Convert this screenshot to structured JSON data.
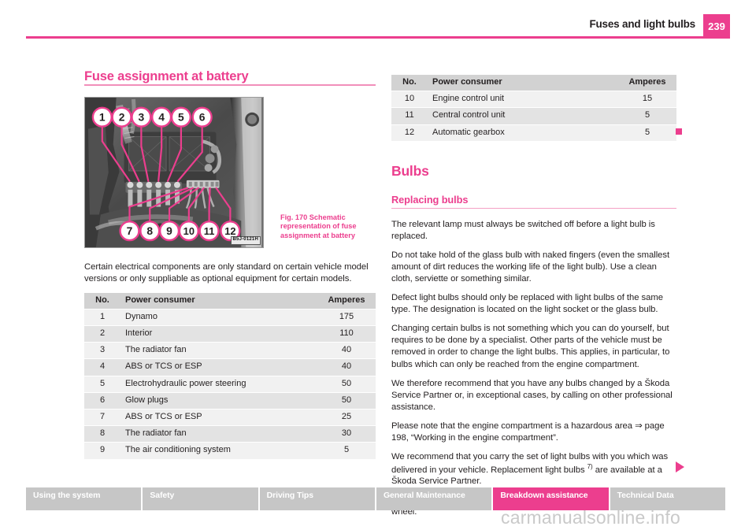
{
  "header": {
    "title": "Fuses and light bulbs",
    "page_number": "239"
  },
  "left_column": {
    "section_title": "Fuse assignment at battery",
    "figure": {
      "caption": "Fig. 170   Schematic representation of fuse assignment at battery",
      "image_code": "B5J-0121H",
      "callout_labels_top": [
        "1",
        "2",
        "3",
        "4",
        "5",
        "6"
      ],
      "callout_labels_bottom": [
        "7",
        "8",
        "9",
        "10",
        "11",
        "12"
      ]
    },
    "intro_paragraph": "Certain electrical components are only standard on certain vehicle model versions or only suppliable as optional equipment for certain models.",
    "table": {
      "columns": [
        "No.",
        "Power consumer",
        "Amperes"
      ],
      "rows": [
        {
          "no": "1",
          "consumer": "Dynamo",
          "amperes": "175"
        },
        {
          "no": "2",
          "consumer": "Interior",
          "amperes": "110"
        },
        {
          "no": "3",
          "consumer": "The radiator fan",
          "amperes": "40"
        },
        {
          "no": "4",
          "consumer": "ABS or TCS or ESP",
          "amperes": "40"
        },
        {
          "no": "5",
          "consumer": "Electrohydraulic power steering",
          "amperes": "50"
        },
        {
          "no": "6",
          "consumer": "Glow plugs",
          "amperes": "50"
        },
        {
          "no": "7",
          "consumer": "ABS or TCS or ESP",
          "amperes": "25"
        },
        {
          "no": "8",
          "consumer": "The radiator fan",
          "amperes": "30"
        },
        {
          "no": "9",
          "consumer": "The air conditioning system",
          "amperes": "5"
        }
      ]
    }
  },
  "right_column": {
    "table": {
      "columns": [
        "No.",
        "Power consumer",
        "Amperes"
      ],
      "rows": [
        {
          "no": "10",
          "consumer": "Engine control unit",
          "amperes": "15"
        },
        {
          "no": "11",
          "consumer": "Central control unit",
          "amperes": "5"
        },
        {
          "no": "12",
          "consumer": "Automatic gearbox",
          "amperes": "5"
        }
      ]
    },
    "chapter_heading": "Bulbs",
    "section_heading": "Replacing bulbs",
    "paragraphs": [
      "The relevant lamp must always be switched off before a light bulb is replaced.",
      "Do not take hold of the glass bulb with naked fingers (even the smallest amount of dirt reduces the working life of the light bulb). Use a clean cloth, serviette or something similar.",
      "Defect light bulbs should only be replaced with light bulbs of the same type. The designation is located on the light socket or the glass bulb.",
      "Changing certain bulbs is not something which you can do yourself, but requires to be done by a specialist. Other parts of the vehicle must be removed in order to change the light bulbs. This applies, in particular, to bulbs which can only be reached from the engine compartment.",
      "We therefore recommend that you have any bulbs changed by a Škoda Service Partner or, in exceptional cases, by calling on other professional assistance.",
      "Please note that the engine compartment is a hazardous area ⇒ page 198, “Working in the engine compartment”.",
      "The set of light bulbs can be stowed in the locable box in the spare wheel."
    ],
    "paragraph_with_footnote": {
      "before": "We recommend that you carry the set of light bulbs with you which was delivered in your vehicle. Replacement light bulbs ",
      "footnote": "7)",
      "after": " are available at a Škoda Service Partner."
    }
  },
  "footer_nav": {
    "tabs": [
      {
        "label": "Using the system",
        "active": false
      },
      {
        "label": "Safety",
        "active": false
      },
      {
        "label": "Driving Tips",
        "active": false
      },
      {
        "label": "General Maintenance",
        "active": false
      },
      {
        "label": "Breakdown assistance",
        "active": true
      },
      {
        "label": "Technical Data",
        "active": false
      }
    ]
  },
  "watermark": "carmanualsonline.info",
  "colors": {
    "accent_pink": "#ec3e8e",
    "light_pink_rule": "#f4a0c4",
    "nav_inactive": "#c6c6c6",
    "table_header": "#d2d2d2",
    "table_row_odd": "#f1f1f1",
    "table_row_even": "#e3e3e3",
    "text": "#231f20",
    "watermark_gray": "#c9c9c9"
  }
}
